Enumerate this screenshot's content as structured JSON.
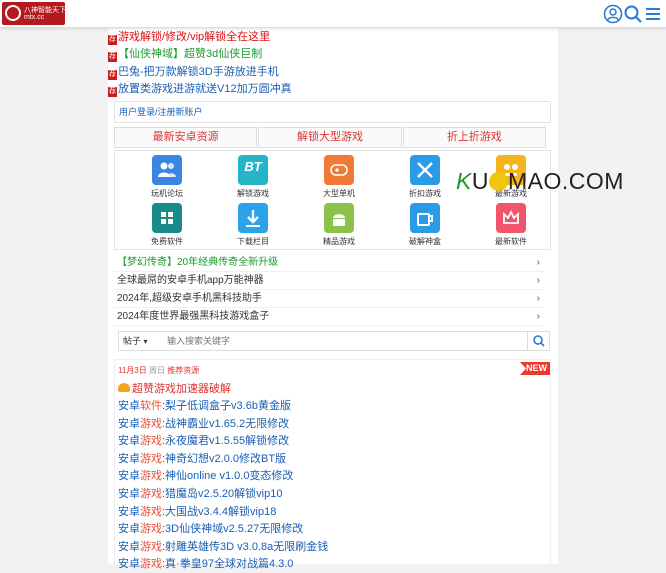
{
  "header": {
    "logo_line1": "八神智能天下",
    "logo_line2": "mtx.cc",
    "icons": [
      "user-circle-icon",
      "search-icon",
      "menu-icon"
    ]
  },
  "ads": [
    {
      "tag": "荐",
      "text": "游戏解锁/修改/vip解锁全在这里",
      "color": "red"
    },
    {
      "tag": "荐",
      "text": "【仙侠神域】超赞3d仙侠巨制",
      "color": "green"
    },
    {
      "tag": "荐",
      "text": "巴兔-把万款解锁3D手游放进手机",
      "color": "blue"
    },
    {
      "tag": "荐",
      "text": "放置类游戏进游就送V12加万圆冲真",
      "color": "blue"
    }
  ],
  "login": "用户登录/注册新账户",
  "tabs": [
    "最新安卓资源",
    "解锁大型游戏",
    "折上折游戏"
  ],
  "grid": [
    {
      "label": "玩机论坛",
      "icon": "users-icon",
      "color": "#3b86e0"
    },
    {
      "label": "解锁游戏",
      "icon": "bt-game-icon",
      "color": "#25b5c9",
      "text": "BT"
    },
    {
      "label": "大型单机",
      "icon": "gamepad-icon",
      "color": "#f07a36"
    },
    {
      "label": "折扣游戏",
      "icon": "tools-icon",
      "color": "#2c9be6"
    },
    {
      "label": "最新游戏",
      "icon": "game-controller-icon",
      "color": "#f4b41c"
    },
    {
      "label": "免费软件",
      "icon": "grid-app-icon",
      "color": "#198c8a"
    },
    {
      "label": "下载栏目",
      "icon": "download-icon",
      "color": "#2aa4e8"
    },
    {
      "label": "精品游戏",
      "icon": "android-icon",
      "color": "#8bc34a"
    },
    {
      "label": "破解神盒",
      "icon": "cup-icon",
      "color": "#2b9be8"
    },
    {
      "label": "最新软件",
      "icon": "crown-icon",
      "color": "#f0556b"
    }
  ],
  "links": [
    {
      "text": "【梦幻传奇】20年经典传奇全新升级",
      "color": "green"
    },
    {
      "text": "全球最屌的安卓手机app万能神器",
      "color": "dark"
    },
    {
      "text": "2024年,超级安卓手机黑科技助手",
      "color": "dark"
    },
    {
      "text": "2024年度世界最强黑科技游戏盒子",
      "color": "dark"
    }
  ],
  "search": {
    "select_value": "帖子",
    "placeholder": "输入搜索关键字"
  },
  "news": {
    "date": "11月3日",
    "weekday": "周日",
    "label": "推荐资源",
    "badge": "NEW",
    "featured": "超赞游戏加速器破解",
    "posts": [
      {
        "prefix": "安卓",
        "cat": "软件",
        "title": ":梨子低调盒子v3.6b黄金版"
      },
      {
        "prefix": "安卓",
        "cat": "游戏",
        "title": ":战神霸业v1.65.2无限修改"
      },
      {
        "prefix": "安卓",
        "cat": "游戏",
        "title": ":永夜魔君v1.5.55解锁修改"
      },
      {
        "prefix": "安卓",
        "cat": "游戏",
        "title": ":神奇幻想v2.0.0修改BT版"
      },
      {
        "prefix": "安卓",
        "cat": "游戏",
        "title": ":神仙online v1.0.0变态修改"
      },
      {
        "prefix": "安卓",
        "cat": "游戏",
        "title": ":猎魔岛v2.5.20解锁vip10"
      },
      {
        "prefix": "安卓",
        "cat": "游戏",
        "title": ":大国战v3.4.4解锁vip18"
      },
      {
        "prefix": "安卓",
        "cat": "游戏",
        "title": ":3D仙侠神域v2.5.27无限修改"
      },
      {
        "prefix": "安卓",
        "cat": "游戏",
        "title": ":射雕英雄传3D v3.0.8a无限刷金钱"
      },
      {
        "prefix": "安卓",
        "cat": "游戏",
        "title": ":真·拳皇97全球对战篇4.3.0"
      }
    ]
  },
  "watermark": {
    "k": "K",
    "middle": "U",
    "rest": "MAO.COM"
  }
}
